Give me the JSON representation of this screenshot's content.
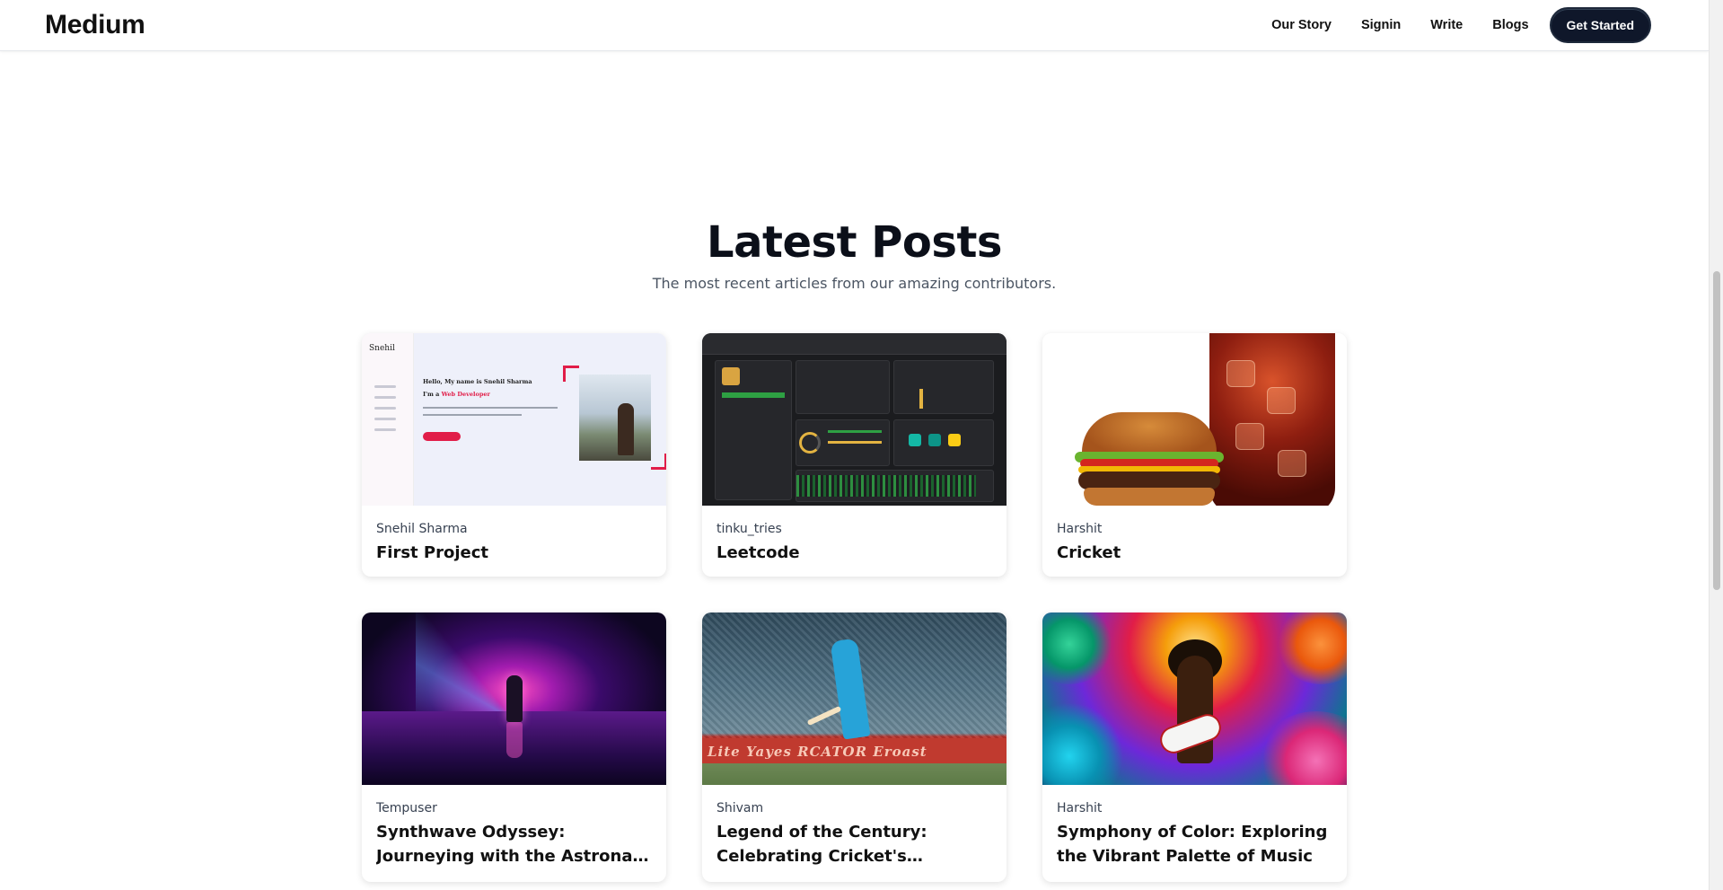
{
  "navbar": {
    "logo": "Medium",
    "links": [
      "Our Story",
      "Signin",
      "Write",
      "Blogs"
    ],
    "cta": "Get Started"
  },
  "section": {
    "title": "Latest Posts",
    "subtitle": "The most recent articles from our amazing contributors."
  },
  "posts": [
    {
      "author": "Snehil Sharma",
      "title": "First Project",
      "thumbnail": "portfolio-website-screenshot"
    },
    {
      "author": "tinku_tries",
      "title": "Leetcode",
      "thumbnail": "leetcode-dark-dashboard-screenshot"
    },
    {
      "author": "Harshit",
      "title": "Cricket",
      "thumbnail": "burger-and-cola-photo"
    },
    {
      "author": "Tempuser",
      "title": "Synthwave Odyssey: Journeying with the Astronaut of Sound",
      "thumbnail": "synthwave-astronaut-art"
    },
    {
      "author": "Shivam",
      "title": "Legend of the Century: Celebrating Cricket's Greatest…",
      "thumbnail": "cricketer-celebration-photo"
    },
    {
      "author": "Harshit",
      "title": "Symphony of Color: Exploring the Vibrant Palette of Music",
      "thumbnail": "psychedelic-guitarist-art"
    }
  ],
  "thumb_text": {
    "brand": "Snehil",
    "hello": "Hello, My name is Snehil Sharma",
    "role_prefix": "I'm a",
    "role": "Web Developer",
    "board": "Lite Yayes   RCATOR  Eroast"
  },
  "colors": {
    "text": "#111111",
    "muted": "#4b5563",
    "cta_bg": "#0f172a",
    "accent_red": "#e11d48"
  }
}
